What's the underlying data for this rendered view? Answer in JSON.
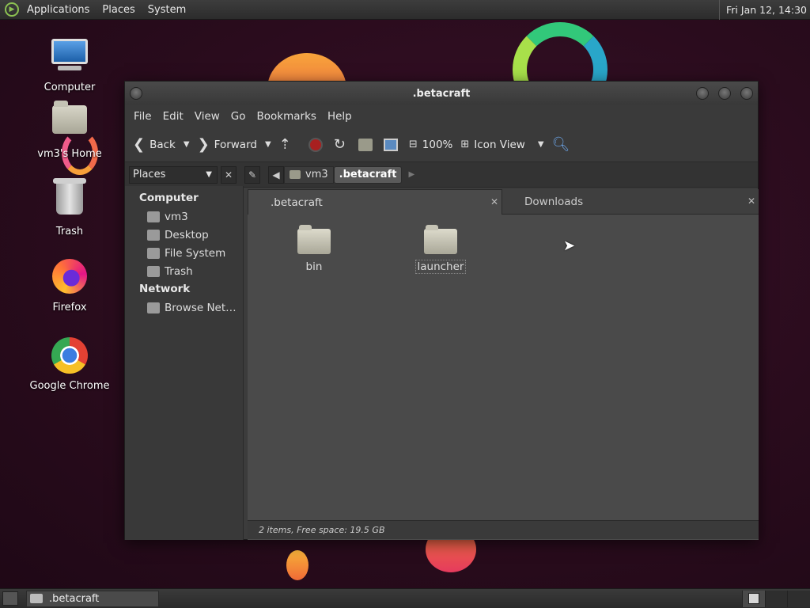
{
  "top_panel": {
    "menus": [
      "Applications",
      "Places",
      "System"
    ],
    "clock": "Fri Jan 12, 14:30"
  },
  "desktop": {
    "icons": [
      {
        "label": "Computer",
        "icon": "computer-icon"
      },
      {
        "label": "vm3's Home",
        "icon": "home-folder-icon"
      },
      {
        "label": "Trash",
        "icon": "trash-icon"
      },
      {
        "label": "Firefox",
        "icon": "firefox-icon"
      },
      {
        "label": "Google Chrome",
        "icon": "chrome-icon"
      }
    ]
  },
  "window": {
    "title": ".betacraft",
    "menubar": [
      "File",
      "Edit",
      "View",
      "Go",
      "Bookmarks",
      "Help"
    ],
    "toolbar": {
      "back": "Back",
      "forward": "Forward",
      "zoom": "100%",
      "view_mode": "Icon View"
    },
    "location": {
      "places_label": "Places",
      "crumbs": [
        "vm3",
        ".betacraft"
      ]
    },
    "sidebar": {
      "sections": [
        {
          "header": "Computer",
          "items": [
            "vm3",
            "Desktop",
            "File System",
            "Trash"
          ]
        },
        {
          "header": "Network",
          "items": [
            "Browse Net…"
          ]
        }
      ]
    },
    "tabs": [
      {
        "label": ".betacraft",
        "active": true
      },
      {
        "label": "Downloads",
        "active": false
      }
    ],
    "files": [
      {
        "name": "bin"
      },
      {
        "name": "launcher"
      }
    ],
    "status": "2 items, Free space: 19.5 GB"
  },
  "bottom_panel": {
    "task": ".betacraft"
  },
  "colors": {
    "accent_stop": "#a82020",
    "panel": "#2c2c2c"
  }
}
